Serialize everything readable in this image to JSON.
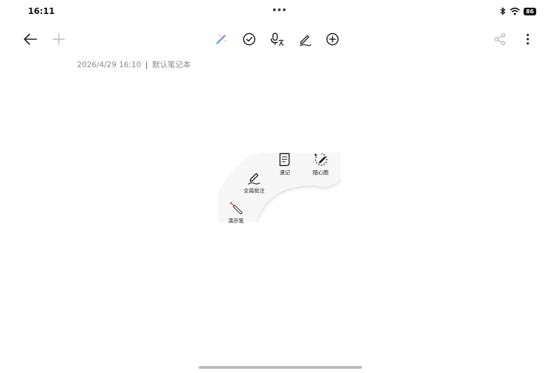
{
  "status_bar": {
    "time": "16:11",
    "battery": "86"
  },
  "toolbar": {
    "left": [
      {
        "name": "back-arrow-icon"
      },
      {
        "name": "add-icon"
      }
    ],
    "center": [
      {
        "name": "ai-magic-pen-icon"
      },
      {
        "name": "checklist-icon"
      },
      {
        "name": "voice-translate-icon"
      },
      {
        "name": "handwriting-pen-icon"
      },
      {
        "name": "insert-plus-icon"
      }
    ],
    "right": [
      {
        "name": "share-icon"
      },
      {
        "name": "more-options-icon"
      }
    ]
  },
  "note_meta": {
    "datetime": "2026/4/29 16:10",
    "separator": "|",
    "notebook": "默认笔记本"
  },
  "arc_menu": {
    "items": [
      {
        "label": "演示笔",
        "icon": "laser-pointer-icon"
      },
      {
        "label": "全局批注",
        "icon": "pen-scribble-icon"
      },
      {
        "label": "速记",
        "icon": "quick-note-icon"
      },
      {
        "label": "随心圈",
        "icon": "circle-select-icon"
      }
    ]
  },
  "colors": {
    "background": "#ffffff",
    "icon": "#1a1a1a",
    "disabled_icon": "#b8b8b8",
    "meta_text": "#8a8a8a",
    "menu_bg": "#f8f8f8",
    "laser_red": "#e0453a"
  }
}
